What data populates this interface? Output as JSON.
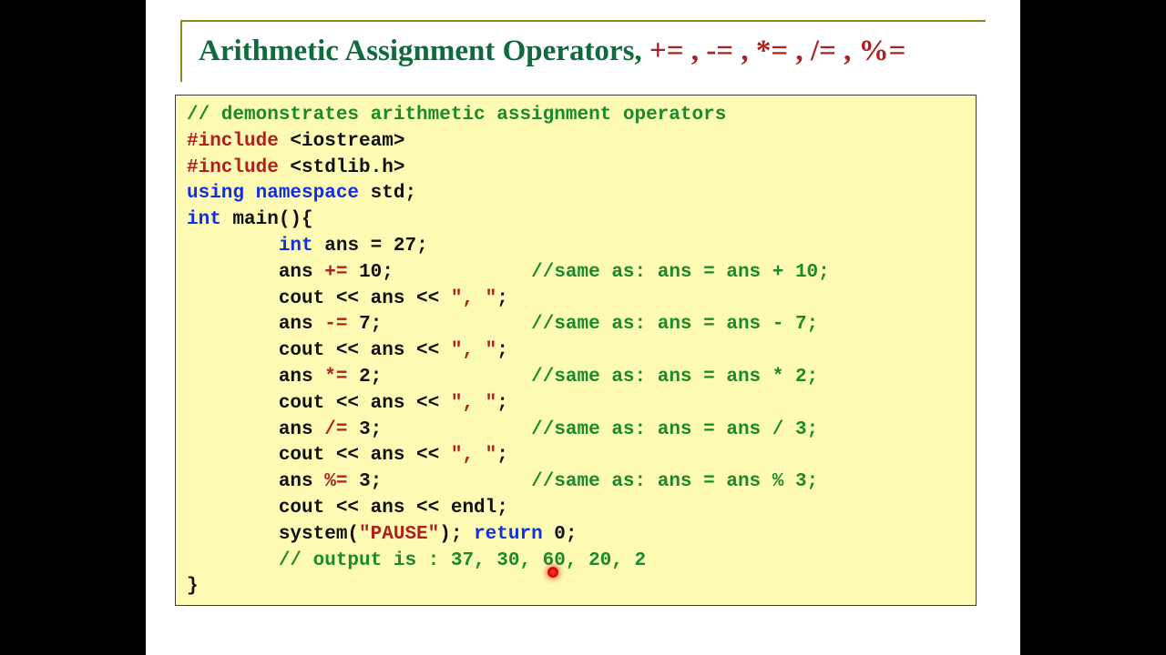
{
  "title": {
    "text_plain": "Arithmetic Assignment Operators, ",
    "ops": "+= , -= , *= , /= , %="
  },
  "code": {
    "c1": "// demonstrates arithmetic assignment operators",
    "inc": "#include ",
    "hdr1": "<iostream>",
    "hdr2": "<stdlib.h>",
    "using": "using namespace ",
    "std": "std;",
    "intk": "int ",
    "main_sig": "main(){",
    "int_decl": "ans = 27;",
    "ans": "ans ",
    "op_pe": "+=",
    "v10": " 10;            ",
    "c_pe": "//same as: ans = ans + 10;",
    "cout_item": "        cout << ans << ",
    "sep": "\", \"",
    "semi": ";",
    "op_me": "-=",
    "v7m": " 7;             ",
    "c_me": "//same as: ans = ans - 7;",
    "op_te": "*=",
    "v2t": " 2;             ",
    "c_te": "//same as: ans = ans * 2;",
    "op_de": "/=",
    "v3d": " 3;             ",
    "c_de": "//same as: ans = ans / 3;",
    "op_re": "%=",
    "v3r": " 3;             ",
    "c_re": "//same as: ans = ans % 3;",
    "cout_endl": "        cout << ans << endl;",
    "sys_pre": "        system(",
    "pause": "\"PAUSE\"",
    "sys_post": "); ",
    "retk": "return ",
    "ret0": "0;",
    "out_cmt": "        // output is : 37, 30, 60, 20, 2",
    "cb": "}"
  }
}
